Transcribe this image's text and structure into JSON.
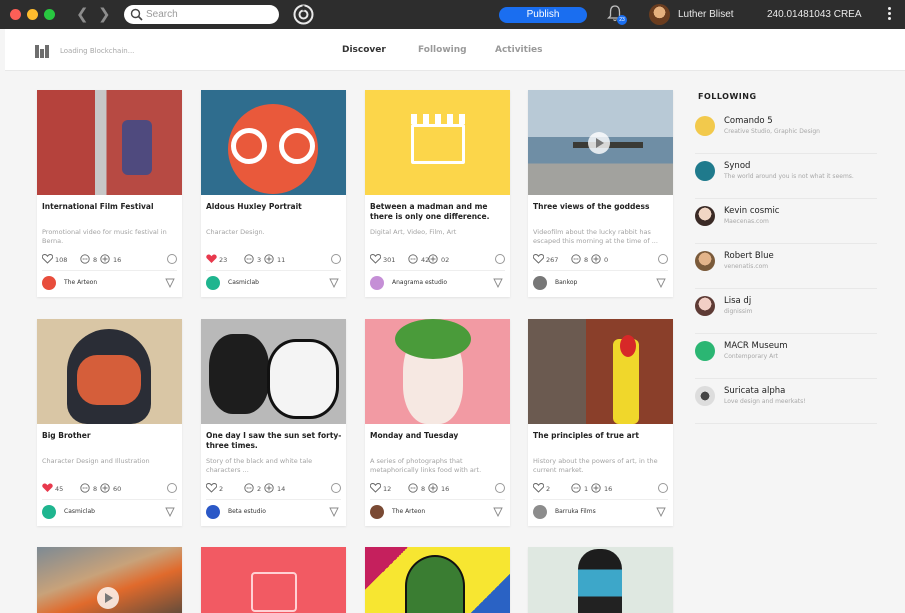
{
  "topbar": {
    "search_placeholder": "Search",
    "publish_label": "Publish",
    "notification_count": "23",
    "user_name": "Luther Bliset",
    "balance": "240.01481043 CREA"
  },
  "subheader": {
    "loading_text": "Loading Blockchain...",
    "tabs": [
      "Discover",
      "Following",
      "Activities"
    ]
  },
  "cards": [
    {
      "title": "International Film Festival",
      "desc": "Promotional video for music festival in Berna.",
      "likes": "108",
      "comments": "8",
      "shares": "16",
      "liked": false,
      "author": "The Arteon"
    },
    {
      "title": "Aldous Huxley Portrait",
      "desc": "Character Design.",
      "likes": "23",
      "comments": "3",
      "shares": "11",
      "liked": true,
      "author": "Casmiclab"
    },
    {
      "title": "Between a madman and me there is only one difference.",
      "desc": "Digital Art, Video, Film, Art",
      "likes": "301",
      "comments": "42",
      "shares": "02",
      "liked": false,
      "author": "Anagrama estudio"
    },
    {
      "title": "Three views of the goddess",
      "desc": "Videofilm about the lucky rabbit has escaped this morning at the time of ...",
      "likes": "267",
      "comments": "8",
      "shares": "0",
      "liked": false,
      "author": "Bankop"
    },
    {
      "title": "Big Brother",
      "desc": "Character Design and Illustration",
      "likes": "45",
      "comments": "8",
      "shares": "60",
      "liked": true,
      "author": "Casmiclab"
    },
    {
      "title": "One day I saw the sun set forty-three times.",
      "desc": "Story of the black and white tale characters ...",
      "likes": "2",
      "comments": "2",
      "shares": "14",
      "liked": false,
      "author": "Beta estudio"
    },
    {
      "title": "Monday and Tuesday",
      "desc": "A series of photographs that metaphorically links food with art.",
      "likes": "12",
      "comments": "8",
      "shares": "16",
      "liked": false,
      "author": "The Arteon"
    },
    {
      "title": "The principles of true art",
      "desc": "History about the powers of art, in the current market.",
      "likes": "2",
      "comments": "1",
      "shares": "16",
      "liked": false,
      "author": "Barruka Films"
    }
  ],
  "following": {
    "title": "FOLLOWING",
    "items": [
      {
        "name": "Comando 5",
        "sub": "Creative Studio, Graphic Design"
      },
      {
        "name": "Synod",
        "sub": "The world around you is not what it seems."
      },
      {
        "name": "Kevin cosmic",
        "sub": "Maecenas.com"
      },
      {
        "name": "Robert Blue",
        "sub": "venenatis.com"
      },
      {
        "name": "Lisa dj",
        "sub": "dignissim"
      },
      {
        "name": "MACR Museum",
        "sub": "Contemporary Art"
      },
      {
        "name": "Suricata alpha",
        "sub": "Love design and meerkats!"
      }
    ]
  },
  "colors": {
    "accent": "#1a6ef0",
    "like_active": "#e8394d",
    "titlebar": "#2d2d2d"
  }
}
